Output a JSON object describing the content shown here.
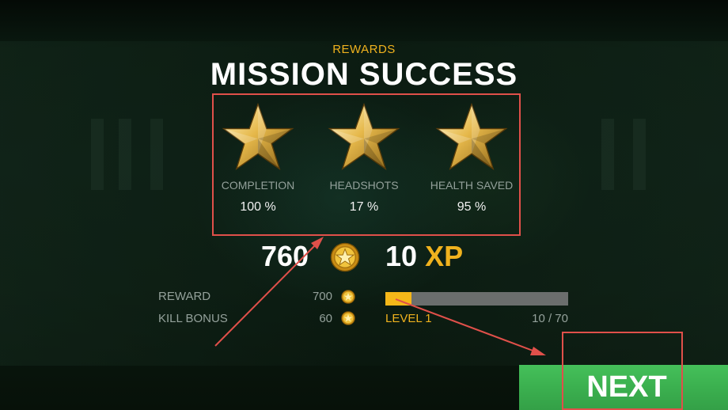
{
  "header": {
    "eyebrow": "REWARDS",
    "title": "MISSION SUCCESS"
  },
  "stars": [
    {
      "label": "COMPLETION",
      "value": "100 %",
      "icon": "star-icon"
    },
    {
      "label": "HEADSHOTS",
      "value": "17 %",
      "icon": "star-icon"
    },
    {
      "label": "HEALTH SAVED",
      "value": "95 %",
      "icon": "star-icon"
    }
  ],
  "totals": {
    "coins": "760",
    "coin_icon": "gold-coin-icon",
    "xp_value": "10",
    "xp_unit": "XP"
  },
  "breakdown": [
    {
      "label": "REWARD",
      "value": "700"
    },
    {
      "label": "KILL BONUS",
      "value": "60"
    }
  ],
  "level": {
    "label": "LEVEL 1",
    "progress_text": "10 / 70",
    "progress_fraction": 0.143
  },
  "buttons": {
    "next_label": "NEXT"
  },
  "colors": {
    "accent_gold": "#f0b21e",
    "button_green": "#3bb04f",
    "annotation_red": "#e0504a",
    "bar_track": "#6b6e6d"
  }
}
